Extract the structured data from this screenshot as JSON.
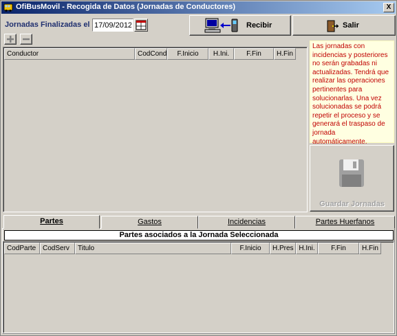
{
  "window": {
    "title": "OfiBusMovil - Recogida de Datos (Jornadas de Conductores)",
    "close_label": "X"
  },
  "toolbar": {
    "date_label": "Jornadas Finalizadas el",
    "date_value": "17/09/2012",
    "receive_label": "Recibir",
    "exit_label": "Salir"
  },
  "jornadas_grid": {
    "columns": [
      "Conductor",
      "CodCond",
      "F.Inicio",
      "H.Ini.",
      "F.Fin",
      "H.Fin"
    ],
    "rows": []
  },
  "notice": "Las jornadas con incidencias y  posteriores no serán grabadas ni actualizadas. Tendrá que realizar las operaciones pertinentes para solucionarlas. Una vez solucionadas se podrá repetir el proceso y se generará el traspaso de jornada automáticamente.",
  "save_button": {
    "label": "Guardar Jornadas",
    "enabled": false
  },
  "tabs": [
    {
      "label": "Partes",
      "active": true
    },
    {
      "label": "Gastos",
      "active": false
    },
    {
      "label": "Incidencias",
      "active": false
    },
    {
      "label": "Partes Huerfanos",
      "active": false
    }
  ],
  "partes_panel": {
    "title": "Partes asociados a la Jornada Seleccionada",
    "columns": [
      "CodParte",
      "CodServ",
      "Titulo",
      "F.Inicio",
      "H.Pres",
      "H.Ini.",
      "F.Fin",
      "H.Fin"
    ],
    "rows": []
  },
  "colors": {
    "window_bg": "#d4d0c8",
    "title_start": "#0a246a",
    "title_end": "#a6caf0",
    "notice_bg": "#ffffe1",
    "notice_text": "#c00000",
    "label_text": "#1f2f6f"
  },
  "icons": {
    "app": "bus-app-icon",
    "calendar": "calendar-icon",
    "receive": "computer-phone-transfer-icon",
    "exit": "exit-door-icon",
    "add": "plus-icon",
    "remove": "minus-icon",
    "save": "floppy-disk-icon"
  }
}
